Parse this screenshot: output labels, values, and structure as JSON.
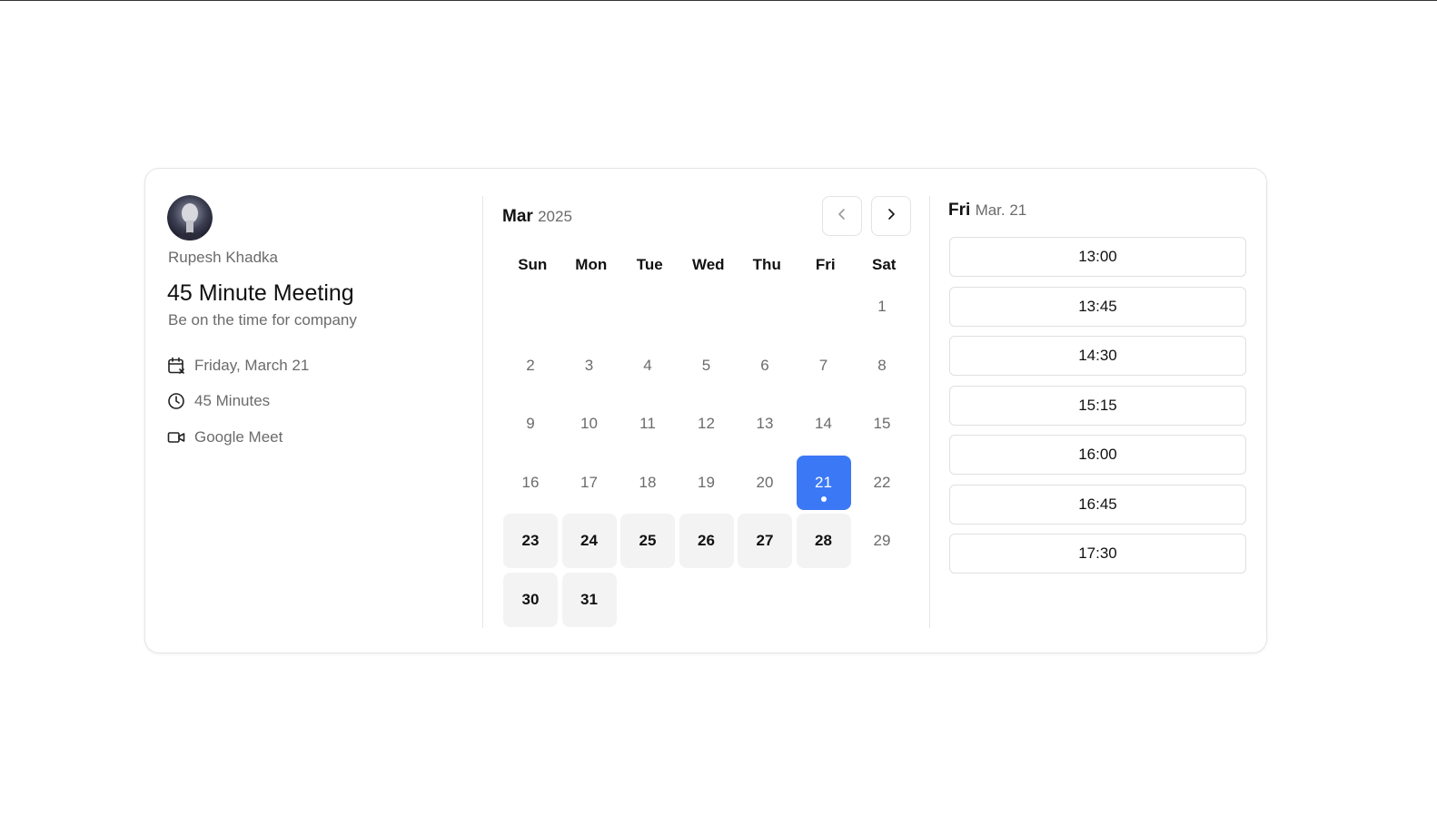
{
  "host": {
    "name": "Rupesh Khadka",
    "avatar_icon": "user-avatar"
  },
  "event": {
    "title": "45 Minute Meeting",
    "description": "Be on the time for company",
    "details": [
      {
        "icon": "calendar-icon",
        "text": "Friday, March 21"
      },
      {
        "icon": "clock-icon",
        "text": "45 Minutes"
      },
      {
        "icon": "video-icon",
        "text": "Google Meet"
      }
    ]
  },
  "calendar": {
    "month": "Mar",
    "year": "2025",
    "weekdays": [
      "Sun",
      "Mon",
      "Tue",
      "Wed",
      "Thu",
      "Fri",
      "Sat"
    ],
    "leading_blanks": 6,
    "days": [
      {
        "n": "1",
        "s": "normal"
      },
      {
        "n": "2",
        "s": "normal"
      },
      {
        "n": "3",
        "s": "normal"
      },
      {
        "n": "4",
        "s": "normal"
      },
      {
        "n": "5",
        "s": "normal"
      },
      {
        "n": "6",
        "s": "normal"
      },
      {
        "n": "7",
        "s": "normal"
      },
      {
        "n": "8",
        "s": "normal"
      },
      {
        "n": "9",
        "s": "normal"
      },
      {
        "n": "10",
        "s": "normal"
      },
      {
        "n": "11",
        "s": "normal"
      },
      {
        "n": "12",
        "s": "normal"
      },
      {
        "n": "13",
        "s": "normal"
      },
      {
        "n": "14",
        "s": "normal"
      },
      {
        "n": "15",
        "s": "normal"
      },
      {
        "n": "16",
        "s": "normal"
      },
      {
        "n": "17",
        "s": "normal"
      },
      {
        "n": "18",
        "s": "normal"
      },
      {
        "n": "19",
        "s": "normal"
      },
      {
        "n": "20",
        "s": "normal"
      },
      {
        "n": "21",
        "s": "selected"
      },
      {
        "n": "22",
        "s": "normal"
      },
      {
        "n": "23",
        "s": "available"
      },
      {
        "n": "24",
        "s": "available"
      },
      {
        "n": "25",
        "s": "available"
      },
      {
        "n": "26",
        "s": "available"
      },
      {
        "n": "27",
        "s": "available"
      },
      {
        "n": "28",
        "s": "available"
      },
      {
        "n": "29",
        "s": "normal"
      },
      {
        "n": "30",
        "s": "available"
      },
      {
        "n": "31",
        "s": "available"
      }
    ],
    "accent_color": "#3b78f6"
  },
  "slots": {
    "day": "Fri",
    "month_day": "Mar. 21",
    "times": [
      "13:00",
      "13:45",
      "14:30",
      "15:15",
      "16:00",
      "16:45",
      "17:30"
    ]
  }
}
